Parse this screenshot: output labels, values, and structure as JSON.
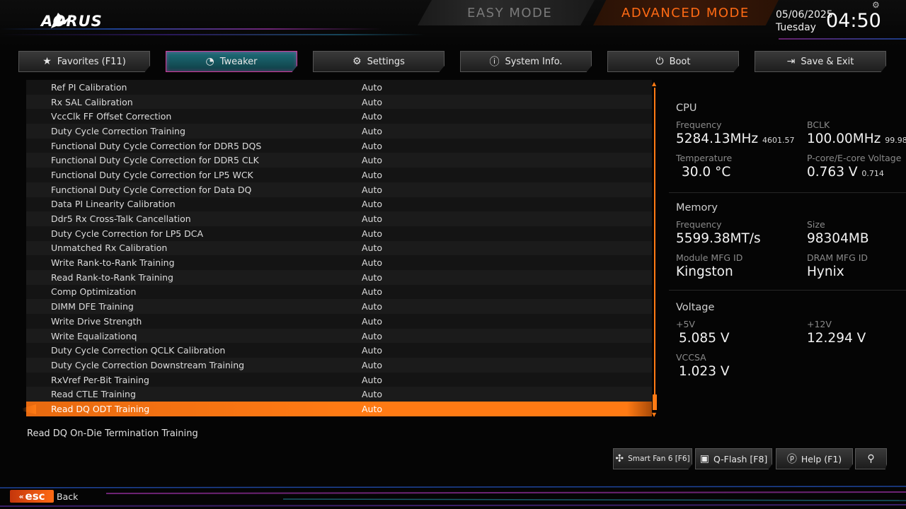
{
  "header": {
    "logo_text": "AORUS",
    "easy_mode": "EASY MODE",
    "advanced_mode": "ADVANCED MODE",
    "date": "05/06/2025",
    "day": "Tuesday",
    "time": "04:50"
  },
  "tabs": [
    {
      "label": "Favorites (F11)",
      "icon": "star-icon",
      "glyph": "★"
    },
    {
      "label": "Tweaker",
      "icon": "speedometer-icon",
      "glyph": "◔"
    },
    {
      "label": "Settings",
      "icon": "gear-icon",
      "glyph": "⚙"
    },
    {
      "label": "System Info.",
      "icon": "info-icon",
      "glyph": "ⓘ"
    },
    {
      "label": "Boot",
      "icon": "power-icon",
      "glyph": "⏻"
    },
    {
      "label": "Save & Exit",
      "icon": "exit-icon",
      "glyph": "⇥"
    }
  ],
  "settings": [
    {
      "name": "Ref PI Calibration",
      "value": "Auto"
    },
    {
      "name": "Rx SAL Calibration",
      "value": "Auto"
    },
    {
      "name": "VccClk FF Offset Correction",
      "value": "Auto"
    },
    {
      "name": "Duty Cycle Correction Training",
      "value": "Auto"
    },
    {
      "name": "Functional Duty Cycle Correction for DDR5 DQS",
      "value": "Auto"
    },
    {
      "name": "Functional Duty Cycle Correction for DDR5 CLK",
      "value": "Auto"
    },
    {
      "name": "Functional Duty Cycle Correction for LP5 WCK",
      "value": "Auto"
    },
    {
      "name": "Functional Duty Cycle Correction for Data DQ",
      "value": "Auto"
    },
    {
      "name": "Data PI Linearity Calibration",
      "value": "Auto"
    },
    {
      "name": "Ddr5 Rx Cross-Talk Cancellation",
      "value": "Auto"
    },
    {
      "name": "Duty Cycle Correction for LP5 DCA",
      "value": "Auto"
    },
    {
      "name": "Unmatched Rx Calibration",
      "value": "Auto"
    },
    {
      "name": "Write Rank-to-Rank Training",
      "value": "Auto"
    },
    {
      "name": "Read Rank-to-Rank Training",
      "value": "Auto"
    },
    {
      "name": "Comp Optimization",
      "value": "Auto"
    },
    {
      "name": "DIMM DFE Training",
      "value": "Auto"
    },
    {
      "name": "Write Drive Strength",
      "value": "Auto"
    },
    {
      "name": "Write Equalizationq",
      "value": "Auto"
    },
    {
      "name": "Duty Cycle Correction QCLK Calibration",
      "value": "Auto"
    },
    {
      "name": "Duty Cycle Correction Downstream Training",
      "value": "Auto"
    },
    {
      "name": "RxVref Per-Bit Training",
      "value": "Auto"
    },
    {
      "name": "Read CTLE Training",
      "value": "Auto"
    },
    {
      "name": "Read DQ ODT Training",
      "value": "Auto",
      "selected": true
    }
  ],
  "description": "Read DQ On-Die Termination Training",
  "panel": {
    "cpu": {
      "title": "CPU",
      "freq_label": "Frequency",
      "freq": "5284.13MHz",
      "freq_sub": "4601.57",
      "bclk_label": "BCLK",
      "bclk": "100.00MHz",
      "bclk_sub": "99.98",
      "temp_label": "Temperature",
      "temp": "30.0 °C",
      "volt_label": "P-core/E-core Voltage",
      "volt": "0.763 V",
      "volt_sub": "0.714"
    },
    "memory": {
      "title": "Memory",
      "freq_label": "Frequency",
      "freq": "5599.38MT/s",
      "size_label": "Size",
      "size": "98304MB",
      "module_label": "Module MFG ID",
      "module": "Kingston",
      "dram_label": "DRAM MFG ID",
      "dram": "Hynix"
    },
    "voltage": {
      "title": "Voltage",
      "v5_label": "+5V",
      "v5": "5.085 V",
      "v12_label": "+12V",
      "v12": "12.294 V",
      "vccsa_label": "VCCSA",
      "vccsa": "1.023 V"
    }
  },
  "bottom_buttons": [
    {
      "label": "Smart Fan 6 [F6]",
      "icon": "fan-icon",
      "glyph": "✣"
    },
    {
      "label": "Q-Flash [F8]",
      "icon": "chip-icon",
      "glyph": "▣"
    },
    {
      "label": "Help (F1)",
      "icon": "help-icon",
      "glyph": "ⓟ"
    },
    {
      "label": "",
      "icon": "search-icon",
      "glyph": "⚲"
    }
  ],
  "footer": {
    "esc": "esc",
    "back": "Back"
  },
  "colors": {
    "accent": "#ff7a14",
    "active_tab": "#1d6f7a",
    "active_tab_border": "#d23c9c"
  }
}
